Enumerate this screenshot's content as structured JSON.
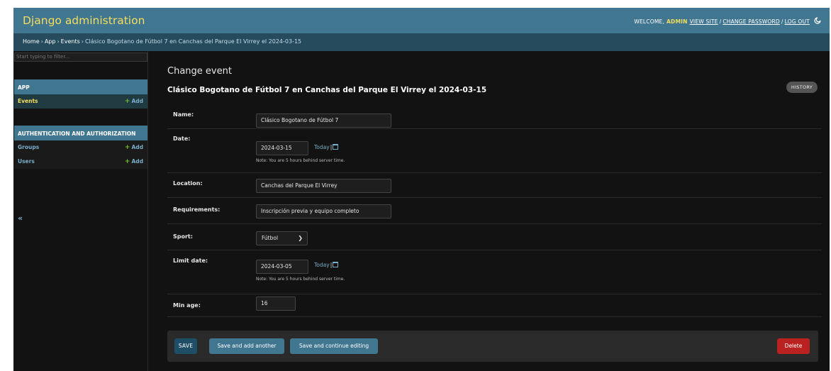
{
  "header": {
    "brand": "Django administration",
    "welcome": "WELCOME,",
    "username": "ADMIN",
    "view_site": "VIEW SITE",
    "change_password": "CHANGE PASSWORD",
    "log_out": "LOG OUT",
    "separator": "/"
  },
  "breadcrumbs": [
    "Home",
    "App",
    "Events",
    "Clásico Bogotano de Fútbol 7 en Canchas del Parque El Virrey el 2024-03-15"
  ],
  "breadcrumb_arrow": "›",
  "sidebar": {
    "filter_placeholder": "Start typing to filter...",
    "modules": [
      {
        "caption": "APP",
        "models": [
          {
            "name": "Events",
            "add": "Add",
            "current": true
          }
        ]
      },
      {
        "caption": "AUTHENTICATION AND AUTHORIZATION",
        "models": [
          {
            "name": "Groups",
            "add": "Add"
          },
          {
            "name": "Users",
            "add": "Add"
          }
        ]
      }
    ],
    "toggle": "«"
  },
  "content": {
    "title": "Change event",
    "object_title": "Clásico Bogotano de Fútbol 7 en Canchas del Parque El Virrey el 2024-03-15",
    "history": "HISTORY"
  },
  "form": {
    "name": {
      "label": "Name:",
      "value": "Clásico Bogotano de Fútbol 7"
    },
    "date": {
      "label": "Date:",
      "value": "2024-03-15",
      "today": "Today",
      "help": "Note: You are 5 hours behind server time."
    },
    "location": {
      "label": "Location:",
      "value": "Canchas del Parque El Virrey"
    },
    "requirements": {
      "label": "Requirements:",
      "value": "Inscripción previa y equipo completo"
    },
    "sport": {
      "label": "Sport:",
      "value": "Fútbol"
    },
    "limit_date": {
      "label": "Limit date:",
      "value": "2024-03-05",
      "today": "Today",
      "help": "Note: You are 5 hours behind server time."
    },
    "min_age": {
      "label": "Min age:",
      "value": "16"
    }
  },
  "submit": {
    "save": "SAVE",
    "save_add_another": "Save and add another",
    "save_continue": "Save and continue editing",
    "delete": "Delete"
  },
  "colors": {
    "header": "#417690",
    "breadcrumbs": "#264b5d",
    "brand": "#f5dd5d",
    "link": "#79aec8",
    "delete": "#ba2121",
    "add_plus": "#70bf2b"
  }
}
